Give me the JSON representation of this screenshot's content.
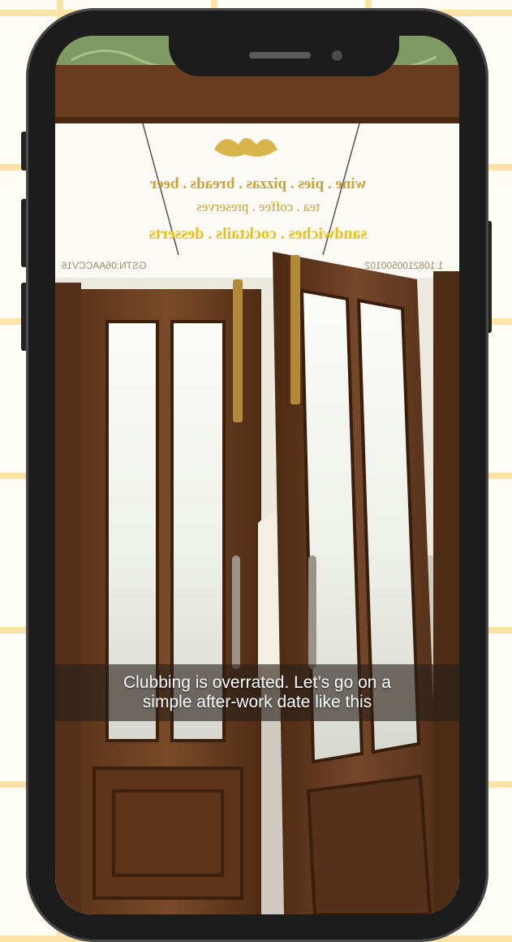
{
  "video": {
    "caption": "Clubbing is overrated. Let’s go on a\nsimple after-work date like this"
  },
  "scene": {
    "sign_line_1": "wine . pies . pizzas . breads . beer",
    "sign_line_2": "tea . coffee . preserves",
    "sign_line_3": "sandwiches . cocktails . desserts",
    "gstin": "GSTN:06AACCV16",
    "phone_no": "1:1082100500102"
  },
  "colors": {
    "frame": "#1c1c1c",
    "wood": "#6a3f22",
    "sign_text": "#c9a23a"
  }
}
